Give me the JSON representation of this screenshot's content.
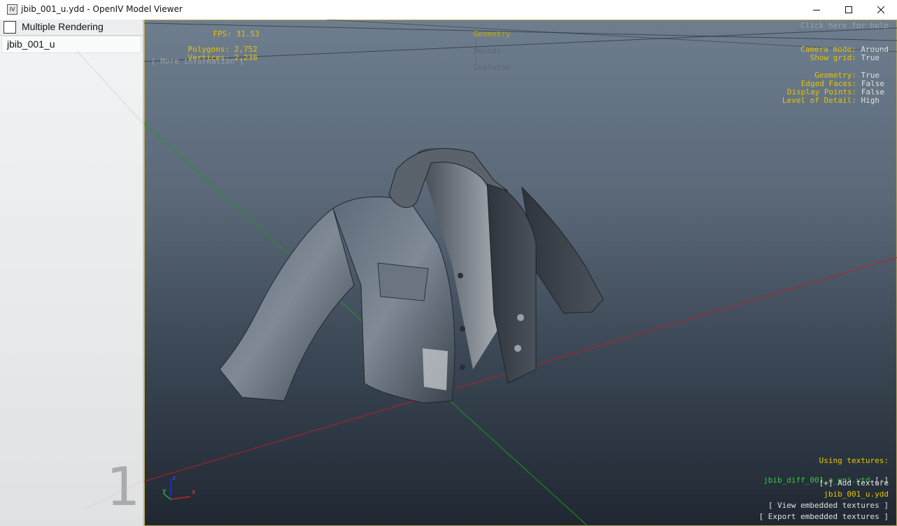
{
  "window": {
    "icon_text": "IV",
    "title": "jbib_001_u.ydd - OpenIV Model Viewer"
  },
  "sidebar": {
    "multiple_rendering_label": "Multiple Rendering",
    "multiple_rendering_checked": false,
    "models": [
      {
        "label": "jbib_001_u"
      }
    ],
    "viewport_number": "1"
  },
  "hud": {
    "fps_label": "FPS:",
    "fps_value": "31.53",
    "polygons_label": "Polygons:",
    "polygons_value": "2,752",
    "vertices_label": "Vertices:",
    "vertices_value": "2,238",
    "more_info": "[ More information ]",
    "tabs": [
      "Geometry",
      "Bounds",
      "Skeleton"
    ],
    "tab_separator": "|",
    "help": "Click here for help",
    "camera_mode_label": "Camera mode:",
    "camera_mode_value": "Around",
    "show_grid_label": "Show grid:",
    "show_grid_value": "True",
    "geometry_label": "Geometry:",
    "geometry_value": "True",
    "edged_faces_label": "Edged Faces:",
    "edged_faces_value": "False",
    "display_points_label": "Display Points:",
    "display_points_value": "False",
    "lod_label": "Level of Detail:",
    "lod_value": "High"
  },
  "textures": {
    "heading": "Using textures:",
    "items": [
      {
        "name": "jbib_diff_001_a_uni.ytd",
        "remove": "[-]"
      }
    ],
    "add_texture": "[+] Add texture",
    "model_file": "jbib_001_u.ydd",
    "view_embedded": "[ View embedded textures ]",
    "export_embedded": "[ Export embedded textures ]"
  },
  "axes_gizmo": {
    "x": "x",
    "y": "y",
    "z": "z"
  },
  "colors": {
    "hud_yellow": "#e6c400",
    "texture_green": "#2fcf3a",
    "grid_red": "#b82020",
    "grid_green": "#1c9a1c"
  }
}
